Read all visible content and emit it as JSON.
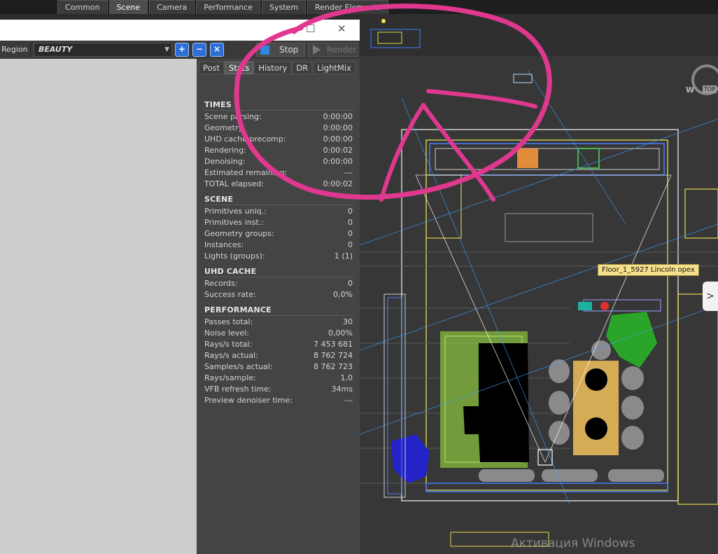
{
  "top_tabs": [
    {
      "label": "Common",
      "active": false
    },
    {
      "label": "Scene",
      "active": true
    },
    {
      "label": "Camera",
      "active": false
    },
    {
      "label": "Performance",
      "active": false
    },
    {
      "label": "System",
      "active": false
    },
    {
      "label": "Render Elements",
      "active": false
    }
  ],
  "window_controls": {
    "maximize": "☐",
    "close": "✕"
  },
  "toolbar": {
    "region_label": "Region",
    "channel_value": "BEAUTY",
    "stop_label": "Stop",
    "render_label": "Render"
  },
  "panel_tabs": [
    {
      "label": "Post",
      "active": false
    },
    {
      "label": "Stats",
      "active": true
    },
    {
      "label": "History",
      "active": false
    },
    {
      "label": "DR",
      "active": false
    },
    {
      "label": "LightMix",
      "active": false
    }
  ],
  "stats": {
    "times": {
      "title": "TIMES",
      "rows": [
        {
          "k": "Scene parsing:",
          "v": "0:00:00"
        },
        {
          "k": "Geometry:",
          "v": "0:00:00"
        },
        {
          "k": "UHD cache precomp:",
          "v": "0:00:00"
        },
        {
          "k": "Rendering:",
          "v": "0:00:02"
        },
        {
          "k": "Denoising:",
          "v": "0:00:00"
        },
        {
          "k": "Estimated remaining:",
          "v": "---"
        },
        {
          "k": "TOTAL elapsed:",
          "v": "0:00:02"
        }
      ]
    },
    "scene": {
      "title": "SCENE",
      "rows": [
        {
          "k": "Primitives uniq.:",
          "v": "0"
        },
        {
          "k": "Primitives inst.:",
          "v": "0"
        },
        {
          "k": "Geometry groups:",
          "v": "0"
        },
        {
          "k": "Instances:",
          "v": "0"
        },
        {
          "k": "Lights (groups):",
          "v": "1 (1)"
        }
      ]
    },
    "uhd_cache": {
      "title": "UHD CACHE",
      "rows": [
        {
          "k": "Records:",
          "v": "0"
        },
        {
          "k": "Success rate:",
          "v": "0,0%"
        }
      ]
    },
    "performance": {
      "title": "PERFORMANCE",
      "rows": [
        {
          "k": "Passes total:",
          "v": "30"
        },
        {
          "k": "Noise level:",
          "v": "0,00%"
        },
        {
          "k": "Rays/s total:",
          "v": "7 453 681"
        },
        {
          "k": "Rays/s actual:",
          "v": "8 762 724"
        },
        {
          "k": "Samples/s actual:",
          "v": "8 762 723"
        },
        {
          "k": "Rays/sample:",
          "v": "1,0"
        },
        {
          "k": "VFB refresh time:",
          "v": "34ms"
        },
        {
          "k": "Preview denoiser time:",
          "v": "---"
        }
      ]
    }
  },
  "viewport": {
    "tooltip": "Floor_1_5927 Lincoln opex",
    "watermark": "Активация Windows",
    "compass_w": "W",
    "compass_top": "TOP"
  },
  "colors": {
    "annotation": "#e0388f",
    "zoom_button": "#2d6fd6",
    "stop_square": "#2e87e0"
  }
}
